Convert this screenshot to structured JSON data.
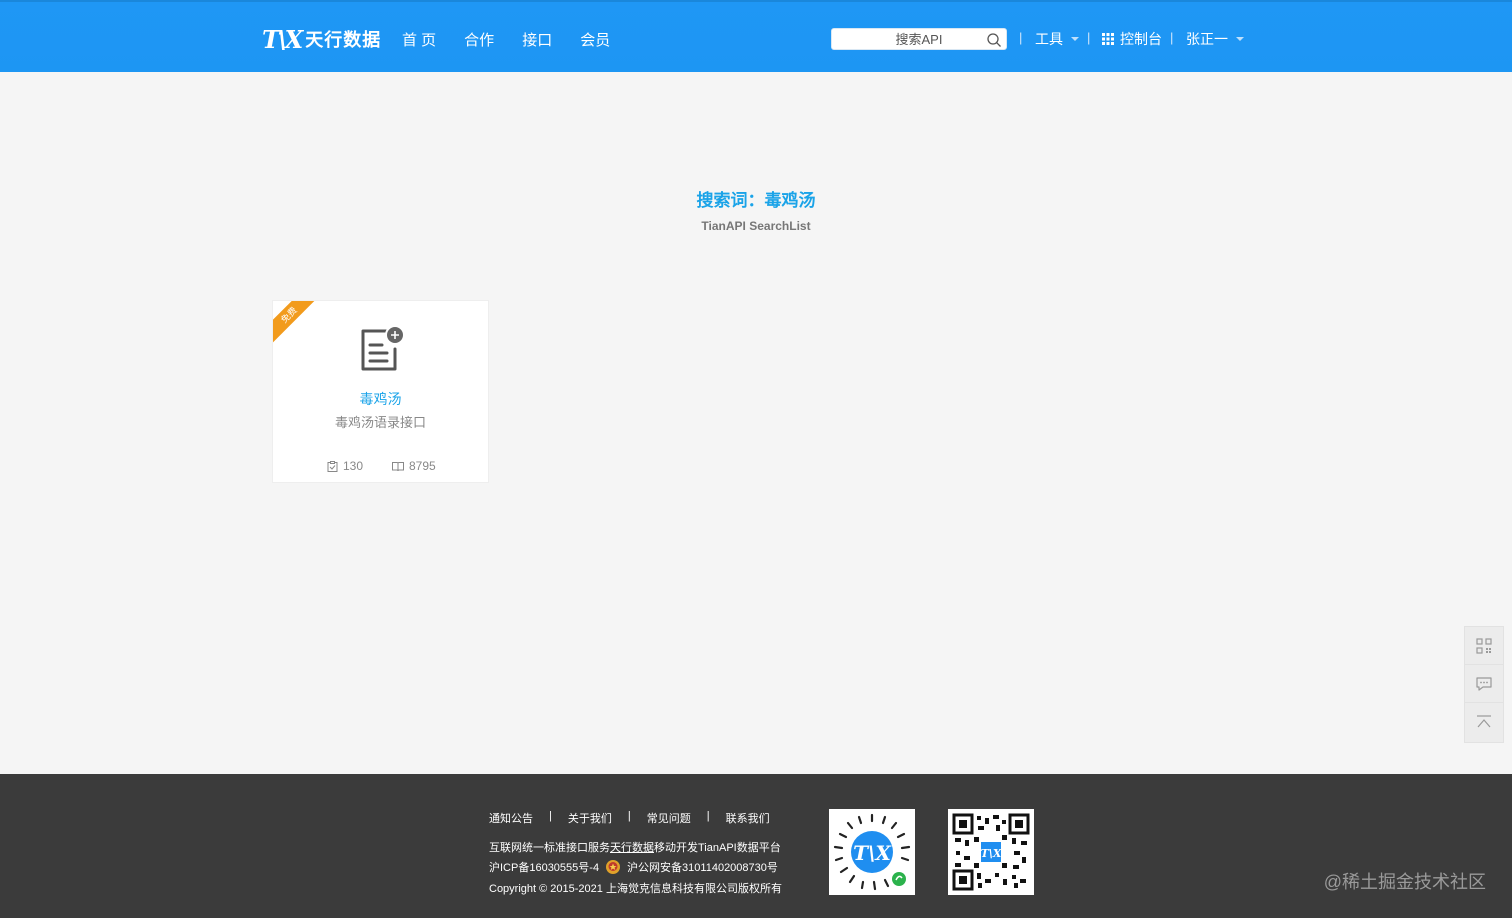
{
  "header": {
    "logo_mark": "T\\X",
    "logo_text": "天行数据",
    "nav": [
      "首 页",
      "合作",
      "接口",
      "会员"
    ],
    "search_placeholder": "搜索API",
    "tools_label": "工具",
    "console_label": "控制台",
    "user_label": "张正一"
  },
  "main": {
    "title": "搜索词：毒鸡汤",
    "subtitle": "TianAPI SearchList"
  },
  "card": {
    "ribbon": "免费",
    "name": "毒鸡汤",
    "description": "毒鸡汤语录接口",
    "stat_apps": "130",
    "stat_calls": "8795"
  },
  "side_tools": {
    "icons": [
      "qrcode-icon",
      "chat-icon",
      "back-to-top-icon"
    ]
  },
  "footer": {
    "links": [
      "通知公告",
      "关于我们",
      "常见问题",
      "联系我们"
    ],
    "separator": "|",
    "line1_a": "互联网统一标准接口服务",
    "line1_link": "天行数据",
    "line1_b": "移动开发TianAPI数据平台",
    "icp": "沪ICP备16030555号-4",
    "police": "沪公网安备31011402008730号",
    "copyright": "Copyright © 2015-2021 上海觉克信息科技有限公司版权所有"
  },
  "watermark": "@稀土掘金技术社区",
  "colors": {
    "header_bg": "#1f97f5",
    "accent": "#1aa3e8",
    "ribbon": "#f29b1c",
    "footer_bg": "#3b3b3b"
  }
}
